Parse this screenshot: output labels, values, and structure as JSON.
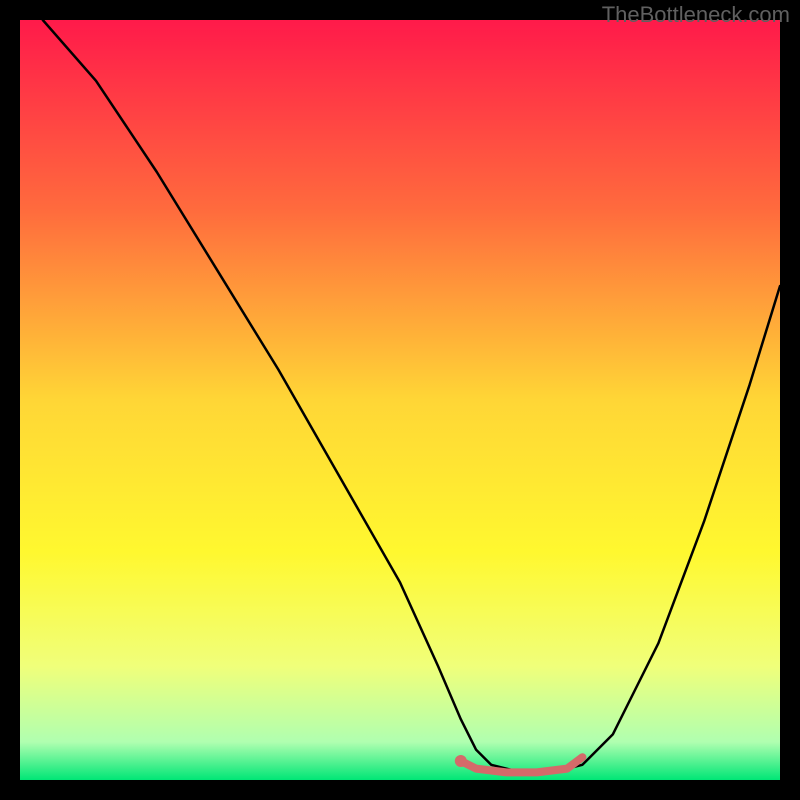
{
  "watermark": "TheBottleneck.com",
  "chart_data": {
    "type": "line",
    "title": "",
    "xlabel": "",
    "ylabel": "",
    "xlim": [
      0,
      100
    ],
    "ylim": [
      0,
      100
    ],
    "background_gradient": {
      "stops": [
        {
          "offset": 0,
          "color": "#ff1a4a"
        },
        {
          "offset": 25,
          "color": "#ff6b3d"
        },
        {
          "offset": 50,
          "color": "#ffd636"
        },
        {
          "offset": 70,
          "color": "#fff82f"
        },
        {
          "offset": 85,
          "color": "#f0ff7a"
        },
        {
          "offset": 95,
          "color": "#b0ffb0"
        },
        {
          "offset": 100,
          "color": "#00e676"
        }
      ]
    },
    "series": [
      {
        "name": "bottleneck-curve",
        "type": "line",
        "color": "#000000",
        "x": [
          3,
          10,
          18,
          26,
          34,
          42,
          50,
          55,
          58,
          60,
          62,
          66,
          70,
          74,
          78,
          84,
          90,
          96,
          100
        ],
        "values": [
          100,
          92,
          80,
          67,
          54,
          40,
          26,
          15,
          8,
          4,
          2,
          1,
          1,
          2,
          6,
          18,
          34,
          52,
          65
        ]
      },
      {
        "name": "optimal-range-marker",
        "type": "line",
        "color": "#d46a6a",
        "stroke_width": 8,
        "x": [
          58,
          60,
          64,
          68,
          72,
          74
        ],
        "values": [
          2.5,
          1.5,
          1,
          1,
          1.5,
          3
        ]
      }
    ],
    "markers": [
      {
        "name": "optimal-point",
        "x": 58,
        "y": 2.5,
        "color": "#d46a6a",
        "size": 6
      }
    ]
  }
}
